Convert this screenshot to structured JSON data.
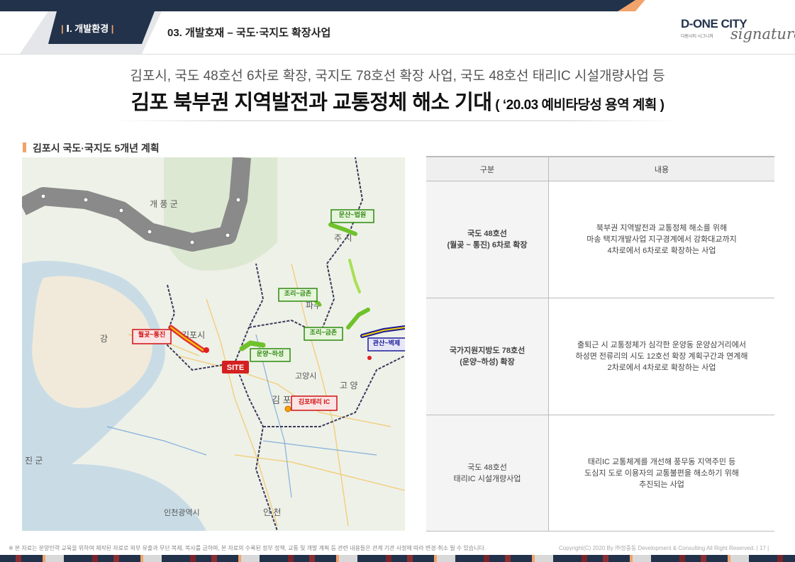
{
  "header": {
    "tab_label": "Ⅰ. 개발환경",
    "section_title": "03. 개발호재 – 국도·국지도 확장사업",
    "logo_main": "D-ONE CITY",
    "logo_sub": "디원시티 시그니처",
    "logo_script": "signature"
  },
  "headings": {
    "subtitle": "김포시, 국도 48호선 6차로 확장, 국지도 78호선 확장 사업, 국도 48호선 태리IC 시설개량사업 등",
    "headline": "김포 북부권 지역발전과 교통정체 해소 기대",
    "headline_small": " ( ‘20.03 예비타당성 용역 계획 )",
    "map_label": "김포시 국도·국지도 5개년 계획"
  },
  "map": {
    "labels": {
      "gaepung": "개  풍  군",
      "paju_city": "주  시",
      "gimpo": "김포시",
      "paju": "파주",
      "goyang": "고양시",
      "goyang2": "고  양",
      "gimpo2": "김  포",
      "incheon": "인천광역시",
      "gang": "강",
      "jin": "진  군",
      "site": "SITE",
      "incheon2": "인  천"
    },
    "tags": {
      "wolgot": "월곶~통진",
      "taeri": "김포태리 IC",
      "unyang": "운양~하성",
      "munsan": "문산~법원",
      "jori": "조리~금촌",
      "jori2": "조리~금촌",
      "gwansan": "관산~벽제"
    },
    "colors": {
      "dmz": "#8a8a8a",
      "route_red": "#e02020",
      "route_green": "#6fc22b",
      "route_blue": "#1a1a9a",
      "border": "#3b3b5c"
    }
  },
  "table": {
    "headers": [
      "구분",
      "내용"
    ],
    "rows": [
      {
        "category": [
          "국도 48호선",
          "(월곶 ~ 통진) 6차로 확장"
        ],
        "content": [
          "북부권 지역발전과 교통정체 해소를 위해",
          "마송 택지개발사업 지구경계에서 강화대교까지",
          "4차로에서 6차로로 확장하는 사업"
        ]
      },
      {
        "category": [
          "국가지원지방도 78호선",
          "(운양~하성) 확장"
        ],
        "content": [
          "출퇴근 시 교통정체가 심각한 운양동 운양삼거리에서",
          "하성면 전류리의 시도 12호선 확장 계획구간과 연계해",
          "2차로에서 4차로로 확장하는 사업"
        ]
      },
      {
        "category": [
          "국도 48호선",
          "태리IC 시설개량사업"
        ],
        "content": [
          "태리IC 교통체계를 개선해 풍무동 지역주민 등",
          "도심지 도로 이용자의 교통불편을 해소하기 위해",
          "추진되는 사업"
        ]
      }
    ]
  },
  "footer": {
    "note": "※ 본 자료는 분양인력 교육을 위하여 제작된 자료로 외부 유출과 무단 복제, 복사를 금하며, 본 자료의 수록된 정부 정책, 교통 및 개발 계획 등 관련 내용들은 관계 기관 사정에 따라 변경·취소 될 수 있습니다.",
    "copyright": "Copyright(C) 2020 By ㈜정중동 Development & Consulting All Right Reserved.",
    "page": "| 17 |"
  }
}
